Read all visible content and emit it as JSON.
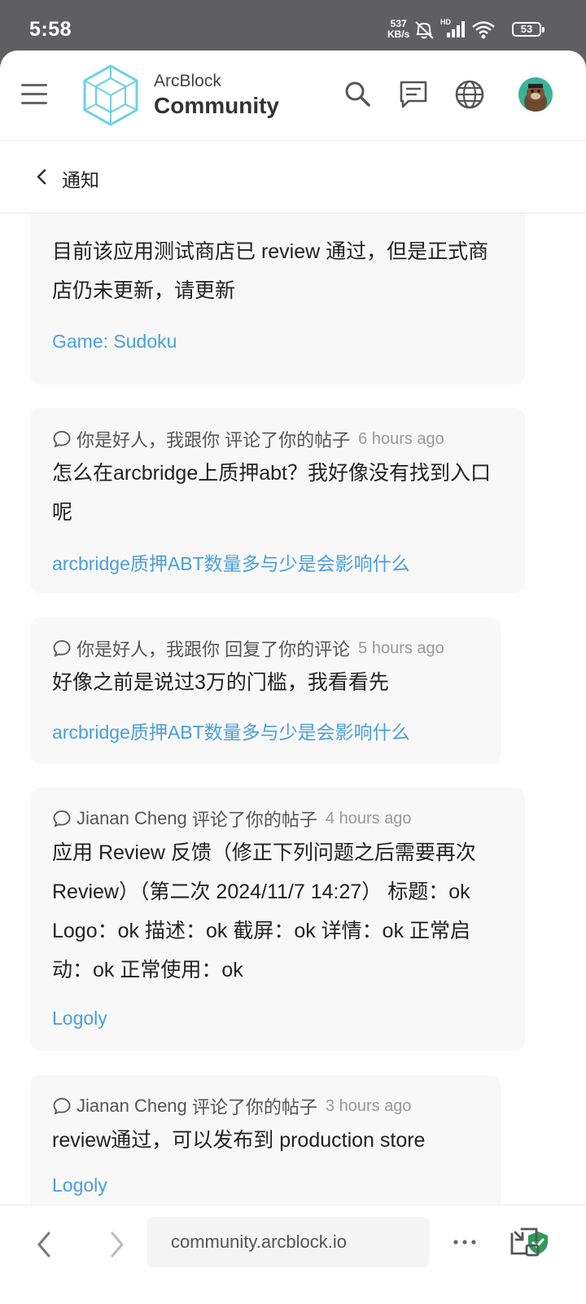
{
  "status": {
    "time": "5:58",
    "rate_value": "537",
    "rate_unit": "KB/s",
    "network": "HD",
    "battery": "53"
  },
  "header": {
    "brand_top": "ArcBlock",
    "brand_bottom": "Community"
  },
  "page": {
    "title": "通知"
  },
  "notifications": [
    {
      "actor": "",
      "action": "",
      "time": "",
      "body": "目前该应用测试商店已 review 通过，但是正式商店仍未更新，请更新",
      "link": "Game: Sudoku"
    },
    {
      "actor": "你是好人，我跟你",
      "action": "评论了你的帖子",
      "time": "6 hours ago",
      "body": "怎么在arcbridge上质押abt？我好像没有找到入口呢",
      "link": "arcbridge质押ABT数量多与少是会影响什么"
    },
    {
      "actor": "你是好人，我跟你",
      "action": "回复了你的评论",
      "time": "5 hours ago",
      "body": "好像之前是说过3万的门槛，我看看先",
      "link": "arcbridge质押ABT数量多与少是会影响什么"
    },
    {
      "actor": "Jianan Cheng",
      "action": "评论了你的帖子",
      "time": "4 hours ago",
      "body": "应用 Review 反馈（修正下列问题之后需要再次 Review）（第二次 2024/11/7 14:27） 标题：ok Logo：ok 描述：ok 截屏：ok 详情：ok 正常启动：ok 正常使用：ok",
      "link": "Logoly"
    },
    {
      "actor": "Jianan Cheng",
      "action": "评论了你的帖子",
      "time": "3 hours ago",
      "body": "review通过，可以发布到 production store",
      "link": "Logoly"
    }
  ],
  "browser": {
    "url": "community.arcblock.io"
  },
  "icons": {
    "menu": "hamburger-icon",
    "search": "search-icon",
    "chat": "chat-icon",
    "language": "globe-icon",
    "back": "chevron-left-icon",
    "comment": "comment-bubble-icon",
    "secure": "shield-check-icon",
    "more": "more-icon",
    "pip": "picture-in-picture-icon"
  },
  "colors": {
    "link": "#4a9fd9",
    "card_bg": "#f8f8f9",
    "status_bg": "#5f5f61",
    "secure": "#2e9a5a"
  }
}
